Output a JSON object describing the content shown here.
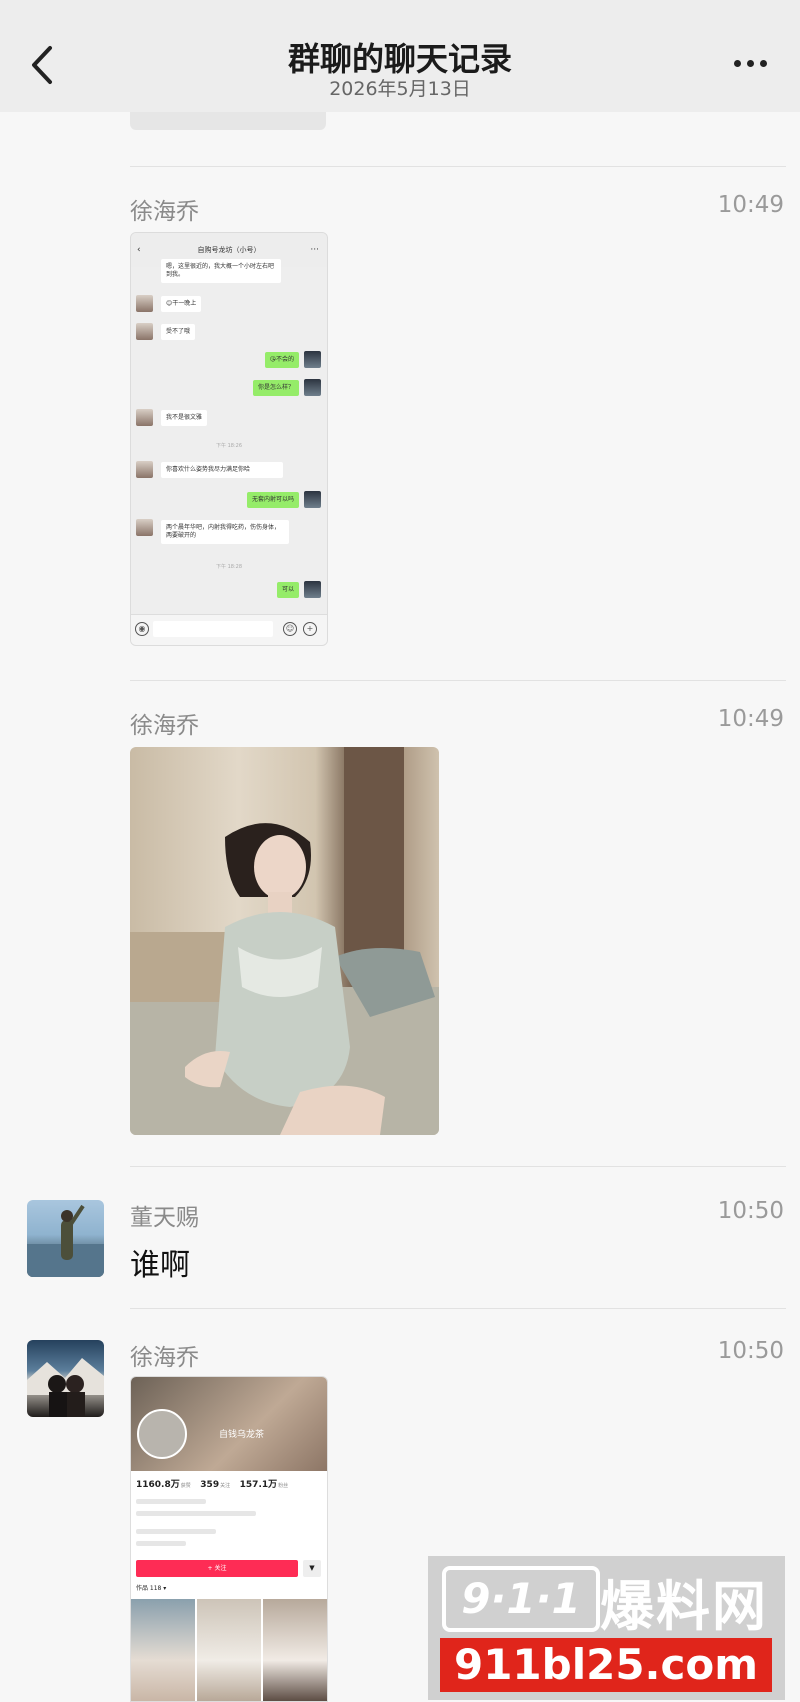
{
  "header": {
    "title": "群聊的聊天记录",
    "date": "2026年5月13日"
  },
  "messages": [
    {
      "sender": "徐海乔",
      "time": "10:49",
      "type": "screenshot-chat",
      "inner": {
        "title": "自购号龙坊（小号）",
        "lines": [
          {
            "side": "left",
            "text": "嗯，这里很近的，我大概一个小时左右吧到我。"
          },
          {
            "side": "left",
            "text": "😊干一晚上"
          },
          {
            "side": "left",
            "text": "受不了哦"
          },
          {
            "side": "right",
            "text": "😘不会的"
          },
          {
            "side": "right",
            "text": "你是怎么样？"
          },
          {
            "side": "left",
            "text": "我不是很文雅"
          },
          {
            "side": "time",
            "text": "下午 18:26"
          },
          {
            "side": "left",
            "text": "你喜欢什么姿势我尽力满足你哈"
          },
          {
            "side": "right",
            "text": "无套内射可以吗"
          },
          {
            "side": "left",
            "text": "两个晨年华吧，内射我得吃药，伤伤身体，两要破开的"
          },
          {
            "side": "time",
            "text": "下午 18:28"
          },
          {
            "side": "right",
            "text": "可以"
          }
        ]
      }
    },
    {
      "sender": "徐海乔",
      "time": "10:49",
      "type": "photo"
    },
    {
      "sender": "董天赐",
      "time": "10:50",
      "type": "text",
      "text": "谁啊"
    },
    {
      "sender": "徐海乔",
      "time": "10:50",
      "type": "screenshot-profile",
      "inner": {
        "nickname": "自钱乌龙茶",
        "stats": [
          {
            "value": "1160.8万",
            "label": "获赞"
          },
          {
            "value": "359",
            "label": "关注"
          },
          {
            "value": "157.1万",
            "label": "粉丝"
          }
        ],
        "follow_label": "+ 关注",
        "tab_label": "作品 118 ▾"
      }
    }
  ],
  "watermark": {
    "logo": "9·1·1",
    "name": "爆料网",
    "url": "911bl25.com"
  },
  "colors": {
    "header_bg": "#ededed",
    "bubble_green": "#95ec69",
    "follow_red": "#fe2c55",
    "watermark_red": "#e0251b"
  }
}
